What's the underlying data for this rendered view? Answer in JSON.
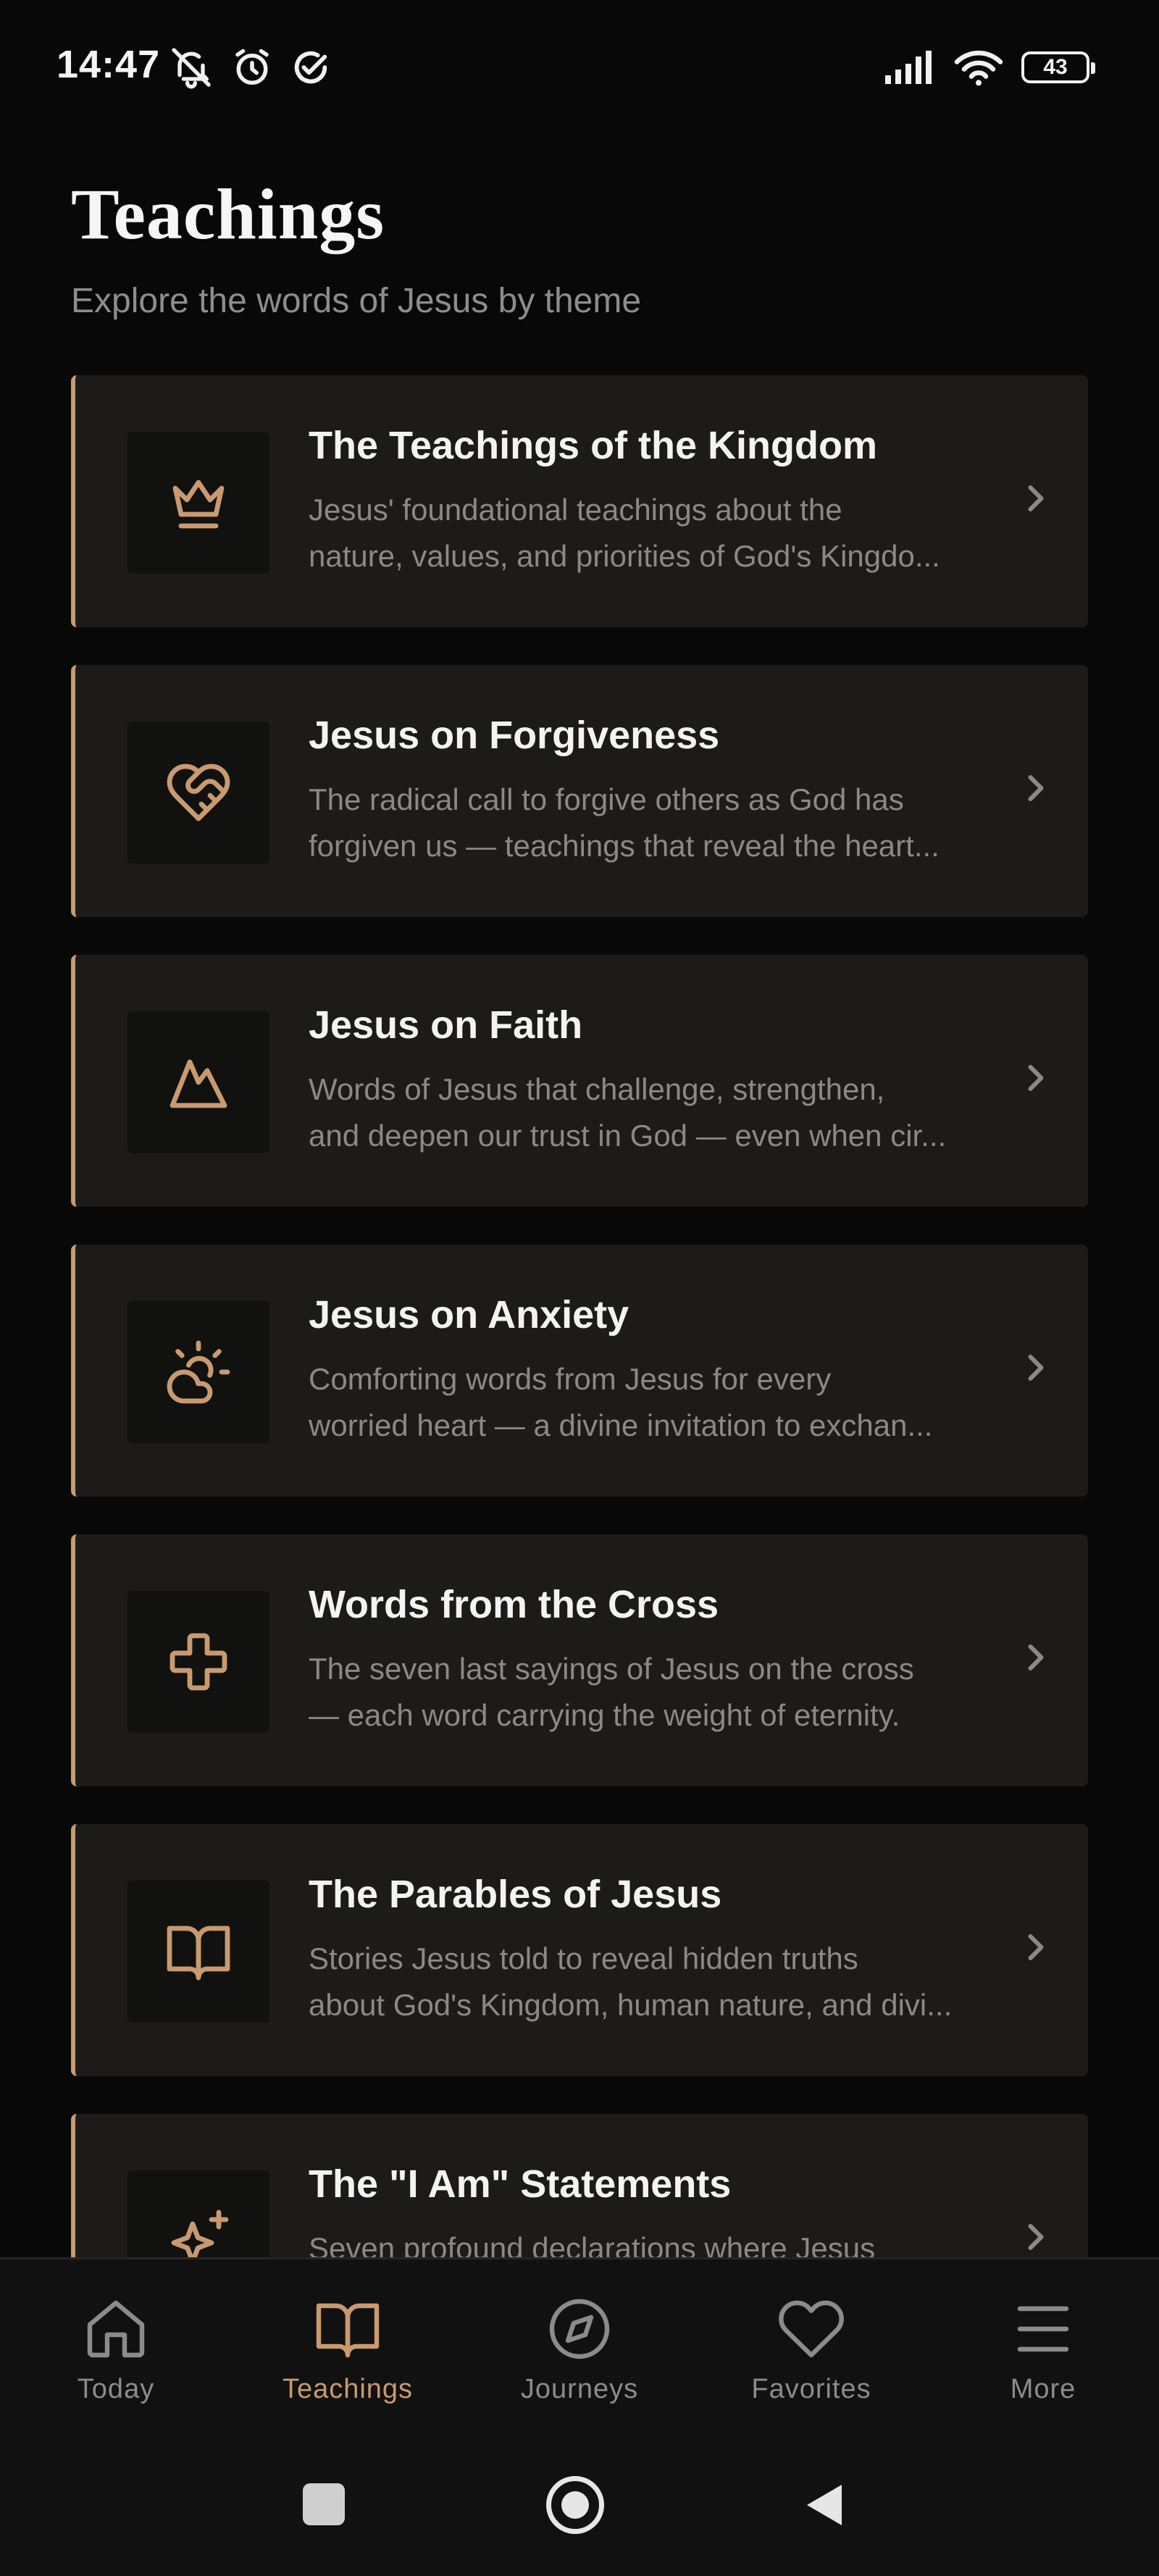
{
  "status_bar": {
    "time": "14:47",
    "battery": "43",
    "left_icons": [
      "mute-icon",
      "alarm-icon",
      "check-circle-icon"
    ],
    "right_icons": [
      "signal-icon",
      "wifi-icon",
      "battery-icon"
    ]
  },
  "header": {
    "title": "Teachings",
    "subtitle": "Explore the words of Jesus by theme"
  },
  "colors": {
    "accent": "#c89a6e",
    "card_bg": "#1c1b19",
    "page_bg": "#080808"
  },
  "teachings": [
    {
      "title": "The Teachings of the Kingdom",
      "desc_line1": "Jesus' foundational teachings about the",
      "desc_line2": "nature, values, and priorities of God's Kingdo...",
      "icon": "crown-icon"
    },
    {
      "title": "Jesus on Forgiveness",
      "desc_line1": "The radical call to forgive others as God has",
      "desc_line2": "forgiven us — teachings that reveal the heart...",
      "icon": "heart-handshake-icon"
    },
    {
      "title": "Jesus on Faith",
      "desc_line1": "Words of Jesus that challenge, strengthen,",
      "desc_line2": "and deepen our trust in God — even when cir...",
      "icon": "mountain-icon"
    },
    {
      "title": "Jesus on Anxiety",
      "desc_line1": "Comforting words from Jesus for every",
      "desc_line2": "worried heart — a divine invitation to exchan...",
      "icon": "cloud-sun-icon"
    },
    {
      "title": "Words from the Cross",
      "desc_line1": "The seven last sayings of Jesus on the cross",
      "desc_line2": "— each word carrying the weight of eternity.",
      "icon": "cross-icon"
    },
    {
      "title": "The Parables of Jesus",
      "desc_line1": "Stories Jesus told to reveal hidden truths",
      "desc_line2": "about God's Kingdom, human nature, and divi...",
      "icon": "open-book-icon"
    },
    {
      "title": "The \"I Am\" Statements",
      "desc_line1": "Seven profound declarations where Jesus",
      "desc_line2": "",
      "icon": "sparkles-icon"
    }
  ],
  "bottom_nav": {
    "items": [
      {
        "label": "Today",
        "icon": "home-icon",
        "active": false
      },
      {
        "label": "Teachings",
        "icon": "open-book-icon",
        "active": true
      },
      {
        "label": "Journeys",
        "icon": "compass-icon",
        "active": false
      },
      {
        "label": "Favorites",
        "icon": "heart-icon",
        "active": false
      },
      {
        "label": "More",
        "icon": "menu-icon",
        "active": false
      }
    ]
  },
  "system_nav": [
    "recents-button",
    "home-button",
    "back-button"
  ]
}
